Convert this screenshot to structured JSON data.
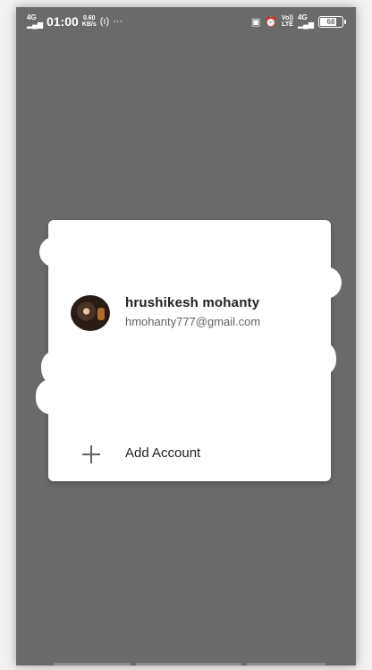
{
  "status_bar": {
    "network": "4G",
    "time": "01:00",
    "speed_value": "0.60",
    "speed_unit": "KB/s",
    "hotspot": "(ı)",
    "more": "···",
    "volte": "Vo))",
    "lte": "LTE",
    "network_right": "4G",
    "battery": "68"
  },
  "dialog": {
    "account": {
      "name": "hrushikesh mohanty",
      "email": "hmohanty777@gmail.com"
    },
    "add_account_label": "Add Account"
  }
}
